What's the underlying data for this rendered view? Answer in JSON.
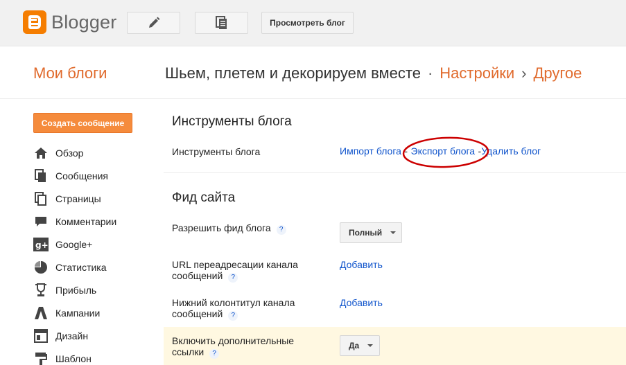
{
  "topbar": {
    "logo_text": "Blogger",
    "pencil_icon": "pencil-icon",
    "pages_icon": "pages-icon",
    "view_blog": "Просмотреть блог"
  },
  "header": {
    "my_blogs": "Мои блоги",
    "blog_name": "Шьем, плетем и декорируем вместе",
    "sep1": "·",
    "settings": "Настройки",
    "sep2": "›",
    "other": "Другое"
  },
  "sidebar": {
    "create_post": "Создать сообщение",
    "items": [
      {
        "label": "Обзор",
        "icon": "home-icon"
      },
      {
        "label": "Сообщения",
        "icon": "posts-icon"
      },
      {
        "label": "Страницы",
        "icon": "pages-icon"
      },
      {
        "label": "Комментарии",
        "icon": "comment-icon"
      },
      {
        "label": "Google+",
        "icon": "google-plus-icon"
      },
      {
        "label": "Статистика",
        "icon": "stats-icon"
      },
      {
        "label": "Прибыль",
        "icon": "trophy-icon"
      },
      {
        "label": "Кампании",
        "icon": "campaigns-icon"
      },
      {
        "label": "Дизайн",
        "icon": "layout-icon"
      },
      {
        "label": "Шаблон",
        "icon": "template-icon"
      }
    ]
  },
  "tools": {
    "section_title": "Инструменты блога",
    "row_label": "Инструменты блога",
    "import": "Импорт блога",
    "export": "Экспорт блога",
    "delete": "Удалить блог",
    "dash": "-"
  },
  "feed": {
    "section_title": "Фид сайта",
    "allow_label": "Разрешить фид блога",
    "allow_value": "Полный",
    "redirect_label_1": "URL переадресации канала",
    "redirect_label_2": "сообщений",
    "redirect_action": "Добавить",
    "footer_label_1": "Нижний колонтитул канала",
    "footer_label_2": "сообщений",
    "footer_action": "Добавить",
    "extra_label_1": "Включить дополнительные",
    "extra_label_2": "ссылки",
    "extra_value": "Да",
    "help": "?"
  },
  "colors": {
    "accent": "#e06a2c",
    "link": "#1155cc",
    "annotation": "#cc0000"
  }
}
